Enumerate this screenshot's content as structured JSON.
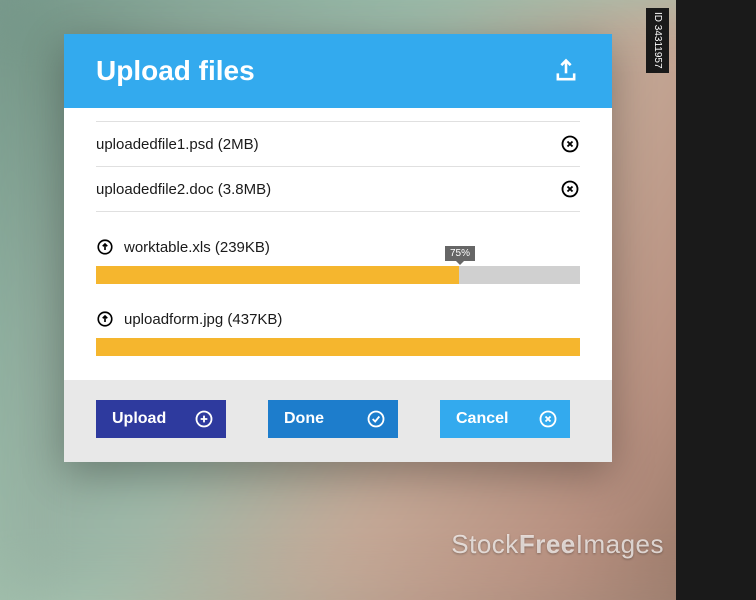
{
  "dialog": {
    "title": "Upload files"
  },
  "completed_files": [
    {
      "name": "uploadedfile1.psd",
      "size": "2MB"
    },
    {
      "name": "uploadedfile2.doc",
      "size": "3.8MB"
    }
  ],
  "uploading_files": [
    {
      "name": "worktable.xls",
      "size": "239KB",
      "progress": 75,
      "show_tip": true
    },
    {
      "name": "uploadform.jpg",
      "size": "437KB",
      "progress": 100,
      "show_tip": false
    }
  ],
  "buttons": {
    "upload": "Upload",
    "done": "Done",
    "cancel": "Cancel"
  },
  "watermark": {
    "id": "ID 34311957",
    "brand_light": "Stock",
    "brand_bold": "Free",
    "brand_tail": "Images"
  }
}
